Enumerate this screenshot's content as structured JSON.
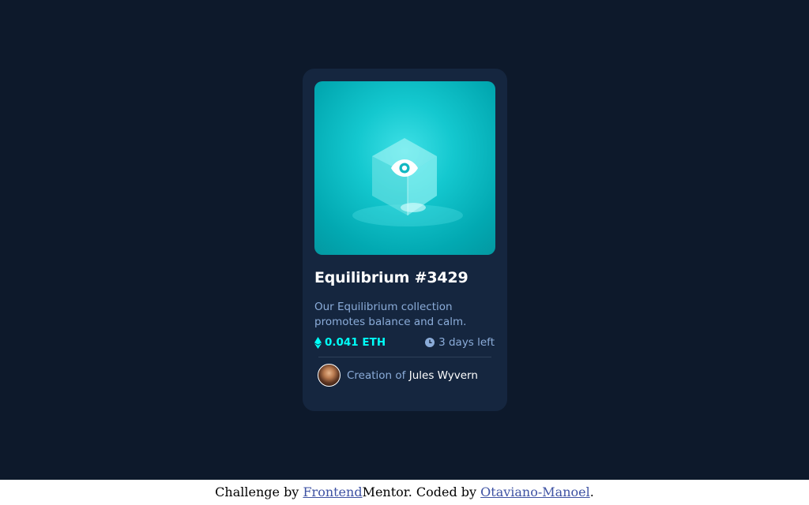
{
  "card": {
    "title": "Equilibrium #3429",
    "description": "Our Equilibrium collection promotes balance and calm.",
    "price": "0.041 ETH",
    "time_left": "3 days left",
    "creator_prefix": "Creation of",
    "creator_name": "Jules Wyvern"
  },
  "footer": {
    "prefix": "Challenge by ",
    "link1": "Frontend",
    "middle": "Mentor. Coded by ",
    "link2": "Otaviano-Manoel",
    "suffix": "."
  },
  "colors": {
    "background": "#0d192b",
    "card": "#15263f",
    "accent": "#00fff8",
    "muted": "#8bacd9"
  },
  "icons": [
    "ethereum-icon",
    "clock-icon",
    "eye-icon"
  ]
}
